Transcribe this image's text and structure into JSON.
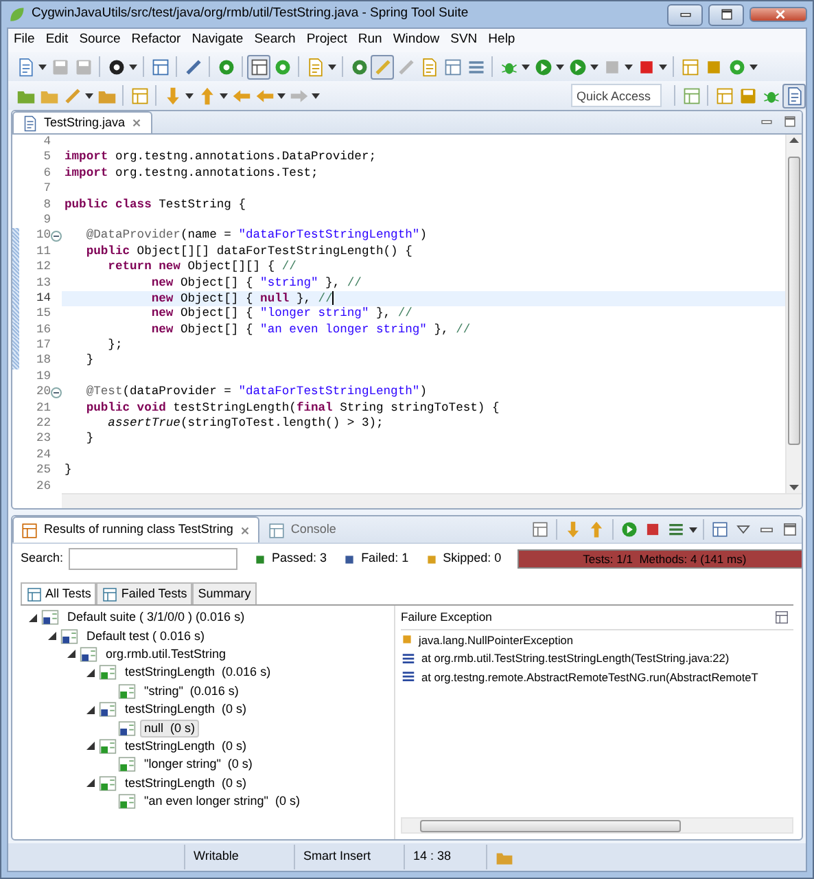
{
  "window": {
    "title": "CygwinJavaUtils/src/test/java/org/rmb/util/TestString.java - Spring Tool Suite"
  },
  "menu": [
    "File",
    "Edit",
    "Source",
    "Refactor",
    "Navigate",
    "Search",
    "Project",
    "Run",
    "Window",
    "SVN",
    "Help"
  ],
  "toolbar_rows": [
    [
      {
        "pressed": false,
        "disabled": false
      },
      {
        "pressed": false,
        "disabled": true
      },
      {
        "pressed": false,
        "disabled": true
      },
      {
        "pressed": false,
        "disabled": false
      },
      {
        "pressed": false,
        "disabled": false
      },
      {
        "pressed": false,
        "disabled": false
      },
      {
        "pressed": false,
        "disabled": false
      },
      {
        "pressed": true,
        "disabled": false
      },
      {
        "pressed": false,
        "disabled": false
      },
      {
        "pressed": false,
        "disabled": false
      },
      {
        "pressed": false,
        "disabled": false
      },
      {
        "pressed": true,
        "disabled": false
      },
      {
        "pressed": false,
        "disabled": true
      },
      {
        "pressed": false,
        "disabled": false
      },
      {
        "pressed": false,
        "disabled": false
      },
      {
        "pressed": false,
        "disabled": false
      },
      {
        "pressed": false,
        "disabled": false
      },
      {
        "pressed": false,
        "disabled": false
      },
      {
        "pressed": false,
        "disabled": false
      },
      {
        "pressed": false,
        "disabled": true
      },
      {
        "pressed": false,
        "disabled": false
      },
      {
        "pressed": false,
        "disabled": false
      },
      {
        "pressed": false,
        "disabled": false
      },
      {
        "pressed": false,
        "disabled": false
      }
    ],
    [
      {
        "pressed": false,
        "disabled": false
      },
      {
        "pressed": false,
        "disabled": false
      },
      {
        "pressed": false,
        "disabled": false
      },
      {
        "pressed": false,
        "disabled": false
      },
      {
        "pressed": false,
        "disabled": false
      },
      {
        "pressed": false,
        "disabled": false
      },
      {
        "pressed": false,
        "disabled": false
      },
      {
        "pressed": false,
        "disabled": false
      },
      {
        "pressed": false,
        "disabled": false
      },
      {
        "pressed": false,
        "disabled": true
      }
    ]
  ],
  "quick_access": {
    "placeholder": "Quick Access"
  },
  "perspective_bar": [
    {
      "pressed": false
    },
    {
      "pressed": false
    },
    {
      "pressed": false
    },
    {
      "pressed": false
    },
    {
      "pressed": true
    }
  ],
  "editor": {
    "tabs": [
      {
        "label": "TestString.java",
        "selected": true
      }
    ],
    "lines": [
      {
        "number": "4",
        "current": false,
        "marked": false,
        "foldable": false
      },
      {
        "number": "5",
        "current": false,
        "marked": false,
        "foldable": false,
        "tokens": [
          {
            "kind": "keyword",
            "text": "import"
          },
          {
            "kind": "plain",
            "text": " org.testng.annotations.DataProvider;"
          }
        ]
      },
      {
        "number": "6",
        "current": false,
        "marked": false,
        "foldable": false,
        "tokens": [
          {
            "kind": "keyword",
            "text": "import"
          },
          {
            "kind": "plain",
            "text": " org.testng.annotations.Test;"
          }
        ]
      },
      {
        "number": "7",
        "current": false,
        "marked": false,
        "foldable": false
      },
      {
        "number": "8",
        "current": false,
        "marked": false,
        "foldable": false,
        "tokens": [
          {
            "kind": "keyword",
            "text": "public class"
          },
          {
            "kind": "plain",
            "text": " TestString {"
          }
        ]
      },
      {
        "number": "9",
        "current": false,
        "marked": false,
        "foldable": false
      },
      {
        "number": "10",
        "current": false,
        "marked": true,
        "foldable": true,
        "tokens": [
          {
            "kind": "annotation",
            "text": "   @DataProvider"
          },
          {
            "kind": "plain",
            "text": "(name = "
          },
          {
            "kind": "string",
            "text": "\"dataForTestStringLength\""
          },
          {
            "kind": "plain",
            "text": ")"
          }
        ]
      },
      {
        "number": "11",
        "current": false,
        "marked": true,
        "foldable": false,
        "tokens": [
          {
            "kind": "keyword",
            "text": "   public"
          },
          {
            "kind": "plain",
            "text": " Object[][] dataForTestStringLength() {"
          }
        ]
      },
      {
        "number": "12",
        "current": false,
        "marked": true,
        "foldable": false,
        "tokens": [
          {
            "kind": "keyword",
            "text": "      return new"
          },
          {
            "kind": "plain",
            "text": " Object[][] { "
          },
          {
            "kind": "comment",
            "text": "//"
          }
        ]
      },
      {
        "number": "13",
        "current": false,
        "marked": true,
        "foldable": false,
        "tokens": [
          {
            "kind": "keyword",
            "text": "            new"
          },
          {
            "kind": "plain",
            "text": " Object[] { "
          },
          {
            "kind": "string",
            "text": "\"string\""
          },
          {
            "kind": "plain",
            "text": " }, "
          },
          {
            "kind": "comment",
            "text": "//"
          }
        ]
      },
      {
        "number": "14",
        "current": true,
        "marked": true,
        "foldable": false,
        "tokens": [
          {
            "kind": "keyword",
            "text": "            new"
          },
          {
            "kind": "plain",
            "text": " Object[] { "
          },
          {
            "kind": "keyword",
            "text": "null"
          },
          {
            "kind": "plain",
            "text": " }, "
          },
          {
            "kind": "comment",
            "text": "//"
          }
        ]
      },
      {
        "number": "15",
        "current": false,
        "marked": true,
        "foldable": false,
        "tokens": [
          {
            "kind": "keyword",
            "text": "            new"
          },
          {
            "kind": "plain",
            "text": " Object[] { "
          },
          {
            "kind": "string",
            "text": "\"longer string\""
          },
          {
            "kind": "plain",
            "text": " }, "
          },
          {
            "kind": "comment",
            "text": "//"
          }
        ]
      },
      {
        "number": "16",
        "current": false,
        "marked": true,
        "foldable": false,
        "tokens": [
          {
            "kind": "keyword",
            "text": "            new"
          },
          {
            "kind": "plain",
            "text": " Object[] { "
          },
          {
            "kind": "string",
            "text": "\"an even longer string\""
          },
          {
            "kind": "plain",
            "text": " }, "
          },
          {
            "kind": "comment",
            "text": "//"
          }
        ]
      },
      {
        "number": "17",
        "current": false,
        "marked": true,
        "foldable": false,
        "tokens": [
          {
            "kind": "plain",
            "text": "      };"
          }
        ]
      },
      {
        "number": "18",
        "current": false,
        "marked": true,
        "foldable": false,
        "tokens": [
          {
            "kind": "plain",
            "text": "   }"
          }
        ]
      },
      {
        "number": "19",
        "current": false,
        "marked": false,
        "foldable": false
      },
      {
        "number": "20",
        "current": false,
        "marked": false,
        "foldable": true,
        "tokens": [
          {
            "kind": "annotation",
            "text": "   @Test"
          },
          {
            "kind": "plain",
            "text": "(dataProvider = "
          },
          {
            "kind": "string",
            "text": "\"dataForTestStringLength\""
          },
          {
            "kind": "plain",
            "text": ")"
          }
        ]
      },
      {
        "number": "21",
        "current": false,
        "marked": false,
        "foldable": false,
        "tokens": [
          {
            "kind": "keyword",
            "text": "   public void"
          },
          {
            "kind": "plain",
            "text": " testStringLength("
          },
          {
            "kind": "keyword",
            "text": "final"
          },
          {
            "kind": "plain",
            "text": " String stringToTest) {"
          }
        ]
      },
      {
        "number": "22",
        "current": false,
        "marked": false,
        "foldable": false,
        "tokens": [
          {
            "kind": "italic",
            "text": "      assertTrue"
          },
          {
            "kind": "plain",
            "text": "(stringToTest.length() > 3);"
          }
        ]
      },
      {
        "number": "23",
        "current": false,
        "marked": false,
        "foldable": false,
        "tokens": [
          {
            "kind": "plain",
            "text": "   }"
          }
        ]
      },
      {
        "number": "24",
        "current": false,
        "marked": false,
        "foldable": false
      },
      {
        "number": "25",
        "current": false,
        "marked": false,
        "foldable": false,
        "tokens": [
          {
            "kind": "plain",
            "text": "}"
          }
        ]
      },
      {
        "number": "26",
        "current": false,
        "marked": false,
        "foldable": false
      }
    ]
  },
  "results": {
    "tabs": [
      {
        "label": "Results of running class TestString",
        "selected": true
      },
      {
        "label": "Console",
        "selected": false
      }
    ],
    "search": {
      "label": "Search:"
    },
    "counters": [
      {
        "kind": "passed",
        "text": "Passed: 3"
      },
      {
        "kind": "failed",
        "text": "Failed: 1"
      },
      {
        "kind": "skipped",
        "text": "Skipped: 0"
      }
    ],
    "progress": {
      "text": "Tests: 1/1  Methods: 4 (141 ms)",
      "level": 1,
      "failed": true
    },
    "view_tabs": [
      {
        "label": "All Tests",
        "selected": true
      },
      {
        "label": "Failed Tests",
        "selected": false
      },
      {
        "label": "Summary",
        "selected": false
      }
    ],
    "tree": [
      {
        "label": "Default suite ( 3/1/0/0 ) (0.016 s)",
        "failed": true,
        "expanded": true,
        "selected": false,
        "children": [
          {
            "label": "Default test ( 0.016 s)",
            "failed": true,
            "expanded": true,
            "selected": false,
            "children": [
              {
                "label": "org.rmb.util.TestString",
                "failed": true,
                "expanded": true,
                "selected": false,
                "children": [
                  {
                    "label": "testStringLength  (0.016 s)",
                    "failed": false,
                    "expanded": true,
                    "selected": false,
                    "children": [
                      {
                        "label": "\"string\"  (0.016 s)",
                        "failed": false,
                        "selected": false
                      }
                    ]
                  },
                  {
                    "label": "testStringLength  (0 s)",
                    "failed": true,
                    "expanded": true,
                    "selected": false,
                    "children": [
                      {
                        "label": "null  (0 s)",
                        "failed": true,
                        "selected": true
                      }
                    ]
                  },
                  {
                    "label": "testStringLength  (0 s)",
                    "failed": false,
                    "expanded": true,
                    "selected": false,
                    "children": [
                      {
                        "label": "\"longer string\"  (0 s)",
                        "failed": false,
                        "selected": false
                      }
                    ]
                  },
                  {
                    "label": "testStringLength  (0 s)",
                    "failed": false,
                    "expanded": true,
                    "selected": false,
                    "children": [
                      {
                        "label": "\"an even longer string\"  (0 s)",
                        "failed": false,
                        "selected": false
                      }
                    ]
                  }
                ]
              }
            ]
          }
        ]
      }
    ],
    "failure": {
      "title": "Failure Exception",
      "trace": [
        {
          "kind": "exception",
          "text": "java.lang.NullPointerException"
        },
        {
          "kind": "frame",
          "text": "at org.rmb.util.TestString.testStringLength(TestString.java:22)"
        },
        {
          "kind": "frame",
          "text": "at org.testng.remote.AbstractRemoteTestNG.run(AbstractRemoteT"
        }
      ]
    }
  },
  "status_bar": [
    "Writable",
    "Smart Insert",
    "14 : 38"
  ]
}
